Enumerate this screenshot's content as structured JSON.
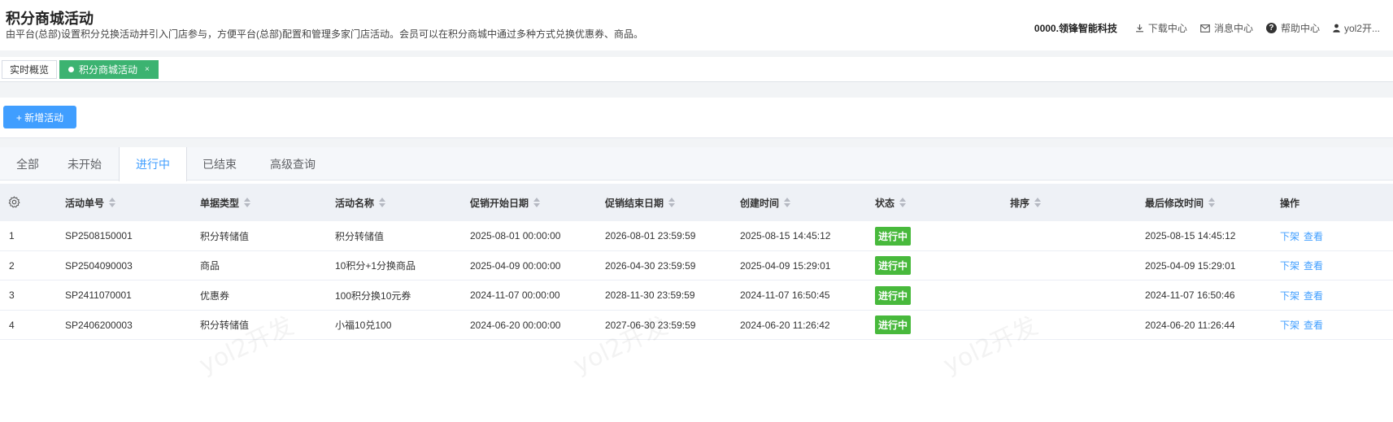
{
  "header": {
    "title": "积分商城活动",
    "description": "由平台(总部)设置积分兑换活动并引入门店参与，方便平台(总部)配置和管理多家门店活动。会员可以在积分商城中通过多种方式兑换优惠券、商品。",
    "company": "0000.领锋智能科技",
    "links": {
      "download": "下载中心",
      "messages": "消息中心",
      "help": "帮助中心",
      "user": "yol2开..."
    }
  },
  "tags": {
    "overview": "实时概览",
    "current": "积分商城活动",
    "close": "×"
  },
  "toolbar": {
    "add_label": "+ 新增活动"
  },
  "tabs": [
    "全部",
    "未开始",
    "进行中",
    "已结束",
    "高级查询"
  ],
  "active_tab": "进行中",
  "table": {
    "columns": [
      "活动单号",
      "单据类型",
      "活动名称",
      "促销开始日期",
      "促销结束日期",
      "创建时间",
      "状态",
      "排序",
      "最后修改时间",
      "操作"
    ],
    "rows": [
      {
        "no": "1",
        "id": "SP2508150001",
        "type": "积分转储值",
        "name": "积分转储值",
        "start": "2025-08-01 00:00:00",
        "end": "2026-08-01 23:59:59",
        "created": "2025-08-15 14:45:12",
        "status": "进行中",
        "sort": "",
        "modified": "2025-08-15 14:45:12",
        "op1": "下架",
        "op2": "查看"
      },
      {
        "no": "2",
        "id": "SP2504090003",
        "type": "商品",
        "name": "10积分+1分换商品",
        "start": "2025-04-09 00:00:00",
        "end": "2026-04-30 23:59:59",
        "created": "2025-04-09 15:29:01",
        "status": "进行中",
        "sort": "",
        "modified": "2025-04-09 15:29:01",
        "op1": "下架",
        "op2": "查看"
      },
      {
        "no": "3",
        "id": "SP2411070001",
        "type": "优惠券",
        "name": "100积分换10元券",
        "start": "2024-11-07 00:00:00",
        "end": "2028-11-30 23:59:59",
        "created": "2024-11-07 16:50:45",
        "status": "进行中",
        "sort": "",
        "modified": "2024-11-07 16:50:46",
        "op1": "下架",
        "op2": "查看"
      },
      {
        "no": "4",
        "id": "SP2406200003",
        "type": "积分转储值",
        "name": "小福10兑100",
        "start": "2024-06-20 00:00:00",
        "end": "2027-06-30 23:59:59",
        "created": "2024-06-20 11:26:42",
        "status": "进行中",
        "sort": "",
        "modified": "2024-06-20 11:26:44",
        "op1": "下架",
        "op2": "查看"
      }
    ]
  },
  "watermark": "yol2开发",
  "colors": {
    "primary": "#409eff",
    "active_tag": "#3cb371",
    "status_green": "#48b93c"
  }
}
